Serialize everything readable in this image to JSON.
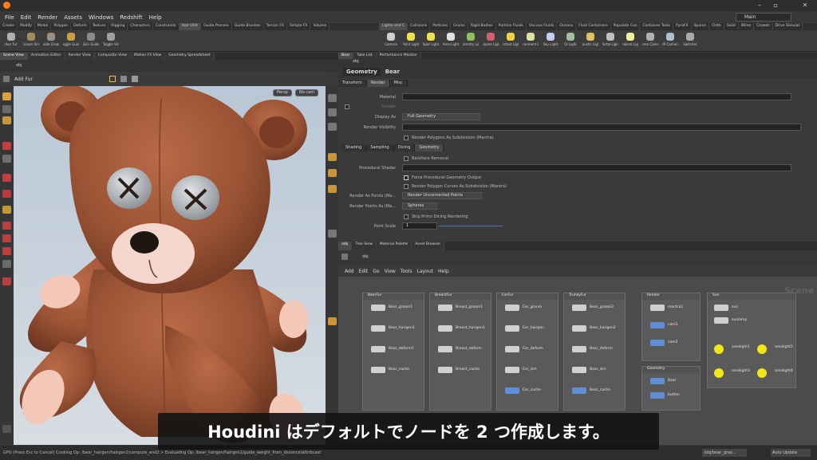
{
  "menu": [
    "File",
    "Edit",
    "Render",
    "Assets",
    "Windows",
    "Redshift",
    "Help"
  ],
  "desktop": "Main",
  "shelf_left_tabs": [
    "Create",
    "Modify",
    "Model",
    "Polygon",
    "Deform",
    "Texture",
    "Rigging",
    "Characters",
    "Constraints",
    "Hair Utils",
    "Guide Process",
    "Guide Brushes",
    "Terrain FX",
    "Simple FX",
    "Volume"
  ],
  "shelf_right_tabs": [
    "Lights and C",
    "Collisions",
    "Particles",
    "Grains",
    "Rigid Bodies",
    "Particle Fluids",
    "Viscous Fluids",
    "Oceans",
    "Fluid Containers",
    "Populate Con",
    "Container Tools",
    "PyroFX",
    "Sparse",
    "Cloth",
    "Solid",
    "Wires",
    "Crowds",
    "Drive Simulat"
  ],
  "shelf_left_tools": [
    "Hair Fur",
    "Groom Sim",
    "Guide Groom",
    "Toggle Guide",
    "Skin Guide",
    "Toggle Vis"
  ],
  "shelf_right_tools": [
    "Camera",
    "Point Light",
    "Spot Light",
    "Area Light",
    "Geometry Light",
    "Volume Light",
    "Distant Light",
    "Environment Light",
    "Sky Light",
    "GI Light",
    "Caustic Light",
    "Portal Light",
    "Ambient Light",
    "Stereo Camera",
    "VR Camera",
    "Switcher"
  ],
  "viewport_tabs": [
    "Scene View",
    "Animation Editor",
    "Render View",
    "Composite View",
    "Motion FX View",
    "Geometry Spreadsheet"
  ],
  "param_tabs": [
    "Tree View",
    "Material Palette",
    "Asset Browser"
  ],
  "path_left": "obj",
  "path_right": "obj",
  "param_top_tabs": [
    "Bear",
    "Take List",
    "Performance Monitor"
  ],
  "viewport_label": "Add Fur",
  "viewport_persp": "Persp",
  "viewport_cam": "No cam",
  "param_title": {
    "type": "Geometry",
    "name": "Bear"
  },
  "param_tabs_main": [
    "Transform",
    "Render",
    "Misc"
  ],
  "param_rows": {
    "material": "Material",
    "shader": "Shader",
    "display_as": "Display As",
    "display_as_val": "Full Geometry",
    "render_vis": "Render Visibility",
    "render_poly": "Render Polygons As Subdivision (Mantra)"
  },
  "param_subtabs": [
    "Shading",
    "Sampling",
    "Dicing",
    "Geometry"
  ],
  "param_rows2": {
    "backface": "Backface Removal",
    "proc_shader": "Procedural Shader",
    "force_proc": "Force Procedural Geometry Output",
    "render_curves": "Render Polygon Curves As Subdivision (Mantra)",
    "rap_label": "Render As Points (Ma...",
    "rap_val": "Render Unconnected Points",
    "rpa_label": "Render Points As (Ma...",
    "rpa_val": "Spheres",
    "skip_dice": "Skip Prims Dicing Rendering",
    "point_scale": "Point Scale",
    "point_scale_val": "1"
  },
  "net_tabs": [
    "/obj",
    "Tree View",
    "Material Palette",
    "Asset Browser"
  ],
  "net_menu": [
    "Add",
    "Edit",
    "Go",
    "View",
    "Tools",
    "Layout",
    "Help"
  ],
  "net_watermark": "Scene",
  "net_boxes": [
    {
      "title": "BearFur",
      "nodes": [
        "Bear_groom1",
        "Bear_hairgen1",
        "Bear_deform1",
        "Bear_cache"
      ]
    },
    {
      "title": "BreastFur",
      "nodes": [
        "Breast_groom1",
        "Breast_hairgen1",
        "Breast_deform",
        "Breast_cache"
      ]
    },
    {
      "title": "EarFur",
      "nodes": [
        "Ear_groom",
        "Ear_hairgen",
        "Ear_deform",
        "Ear_sim",
        "Ear_cache"
      ]
    },
    {
      "title": "TrunkyFur",
      "nodes": [
        "Bear_groom2",
        "Bear_hairgen2",
        "Bear_deform",
        "Bear_sim",
        "Bear_cache"
      ]
    },
    {
      "title": "Render",
      "nodes": [
        "mantra1",
        "cam1",
        "cam2"
      ]
    },
    {
      "title": "Geometry",
      "nodes": [
        "Bear",
        "button"
      ]
    },
    {
      "title": "Sun",
      "nodes": [
        "sun",
        "sunlamp",
        "arealight1",
        "arealight2",
        "arealight3",
        "arealight4"
      ]
    }
  ],
  "status_text": "GPU (Press Esc to Cancel) Cooking Op: /bear_hairgen/hairgen1/compute_end2 > Evaluating Op: /bear_hairgen/hairgen1/guide_weight_from_distance/attribcast",
  "status_right": [
    "/obj/bear_groo...",
    "Auto Update"
  ],
  "subtitle": "Houdini はデフォルトでノードを 2 つ作成します。",
  "colors": {
    "accent": "#ff7a1a",
    "node_blue": "#5f8ed6",
    "light_yellow": "#f2e51a",
    "bear": "#a0583a"
  }
}
